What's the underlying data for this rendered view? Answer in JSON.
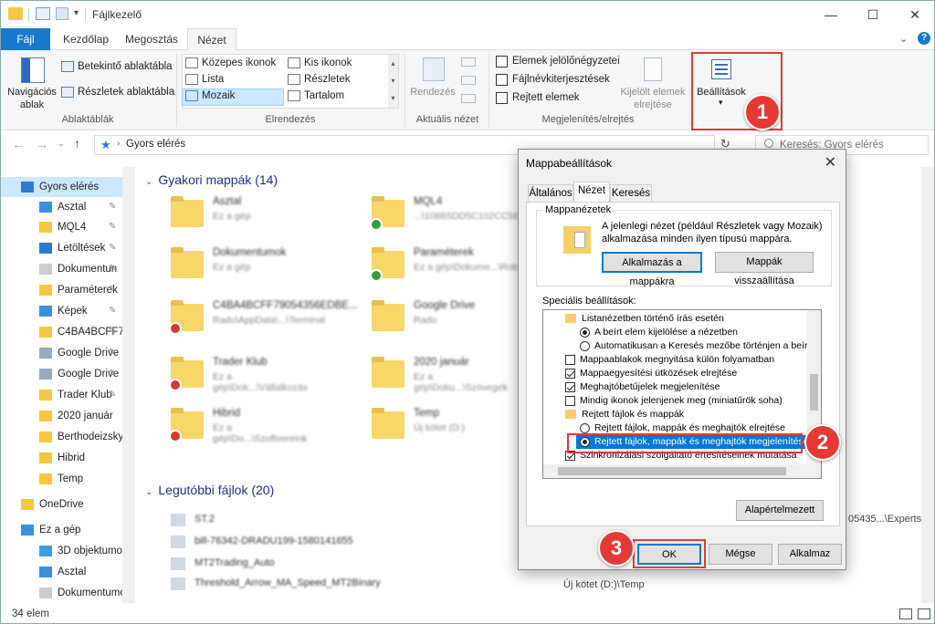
{
  "window": {
    "title": "Fájlkezelő"
  },
  "tabs": [
    "Fájl",
    "Kezdőlap",
    "Megosztás",
    "Nézet"
  ],
  "ribbon": {
    "panes": {
      "nav_pane": "Navigációs",
      "nav_pane2": "ablak",
      "preview": "Betekintő ablaktábla",
      "details": "Részletek ablaktábla",
      "group": "Ablaktáblák"
    },
    "layout": {
      "items": [
        "Közepes ikonok",
        "Kis ikonok",
        "Lista",
        "Részletek",
        "Mozaik",
        "Tartalom"
      ],
      "group": "Elrendezés"
    },
    "current": {
      "sort": "Rendezés",
      "group": "Aktuális nézet"
    },
    "showhide": {
      "items": [
        "Elemek jelölőnégyzetei",
        "Fájlnévkiterjesztések",
        "Rejtett elemek"
      ],
      "hide_sel": "Kijelölt elemek",
      "hide_sel2": "elrejtése",
      "group": "Megjelenítés/elrejtés"
    },
    "options": "Beállítások"
  },
  "address": {
    "path": "Gyors elérés",
    "search_placeholder": "Keresés: Gyors elérés"
  },
  "nav": {
    "items": [
      "Gyors elérés",
      "Asztal",
      "MQL4",
      "Letöltések",
      "Dokumentun",
      "Paraméterek",
      "Képek",
      "C4BA4BCFF79",
      "Google Drive",
      "Google Drive",
      "Trader Klub",
      "2020 január",
      "Berthodeizsky-G",
      "Hibrid",
      "Temp",
      "OneDrive",
      "Ez a gép",
      "3D objektumok",
      "Asztal",
      "Dokumentumok"
    ]
  },
  "content": {
    "frequent_title": "Gyakori mappák (14)",
    "recent_title": "Legutóbbi fájlok (20)",
    "folders": [
      {
        "name": "Asztal",
        "sub": "Ez a gép"
      },
      {
        "name": "MQL4",
        "sub": "...\\1088SDD5C102CC5825..."
      },
      {
        "name": "Dokumentumok",
        "sub": "Ez a gép"
      },
      {
        "name": "Paraméterek",
        "sub": "Ez a gép\\Dokume...\\Rob"
      },
      {
        "name": "C4BA4BCFF79054356EDBE...",
        "sub": "Radu\\AppData\\...\\Terminal"
      },
      {
        "name": "Google Drive",
        "sub": "Radu"
      },
      {
        "name": "Trader Klub",
        "sub": "Ez a gép\\Dok...\\Vállalkozás"
      },
      {
        "name": "2020 január",
        "sub": "Ez a gép\\Doku...\\Szövegek"
      },
      {
        "name": "Hibrid",
        "sub": "Ez a gép\\Do...\\Szoftvereink"
      },
      {
        "name": "Temp",
        "sub": "Új kötet (D:)"
      }
    ],
    "recent": [
      "ST.2",
      "bill-76342-DRADU199-1580141655",
      "MT2Trading_Auto",
      "Threshold_Arrow_MA_Speed_MT2Binary",
      ""
    ],
    "right_texts": [
      "05435...\\Experts",
      "Új kötet (D:)\\Temp"
    ]
  },
  "status": {
    "count": "34 elem"
  },
  "dialog": {
    "title": "Mappabeállítások",
    "tabs": [
      "Általános",
      "Nézet",
      "Keresés"
    ],
    "views_group": "Mappanézetek",
    "views_text1": "A jelenlegi nézet (például Részletek vagy Mozaik)",
    "views_text2": "alkalmazása minden ilyen típusú mappára.",
    "apply_btn": "Alkalmazás a mappákra",
    "reset_btn": "Mappák visszaállítása",
    "advanced_label": "Speciális beállítások:",
    "advanced": [
      "Listanézetben történő írás esetén",
      "A beírt elem kijelölése a nézetben",
      "Automatikusan a Keresés mezőbe történjen a beírás",
      "Mappaablakok megnyitása külön folyamatban",
      "Mappaegyesítési ütközések elrejtése",
      "Meghajtóbetűjelek megjelenítése",
      "Mindig ikonok jelenjenek meg (miniatűrök soha)",
      "Rejtett fájlok és mappák",
      "Rejtett fájlok, mappák és meghajtók elrejtése",
      "Rejtett fájlok, mappák és meghajtók megjelenítése",
      "Szinkronizálási szolgáltató értesítéseinek mutatása"
    ],
    "defaults_btn": "Alapértelmezett",
    "ok_btn": "OK",
    "cancel_btn": "Mégse",
    "apply": "Alkalmaz"
  },
  "annotations": [
    "1",
    "2",
    "3"
  ]
}
